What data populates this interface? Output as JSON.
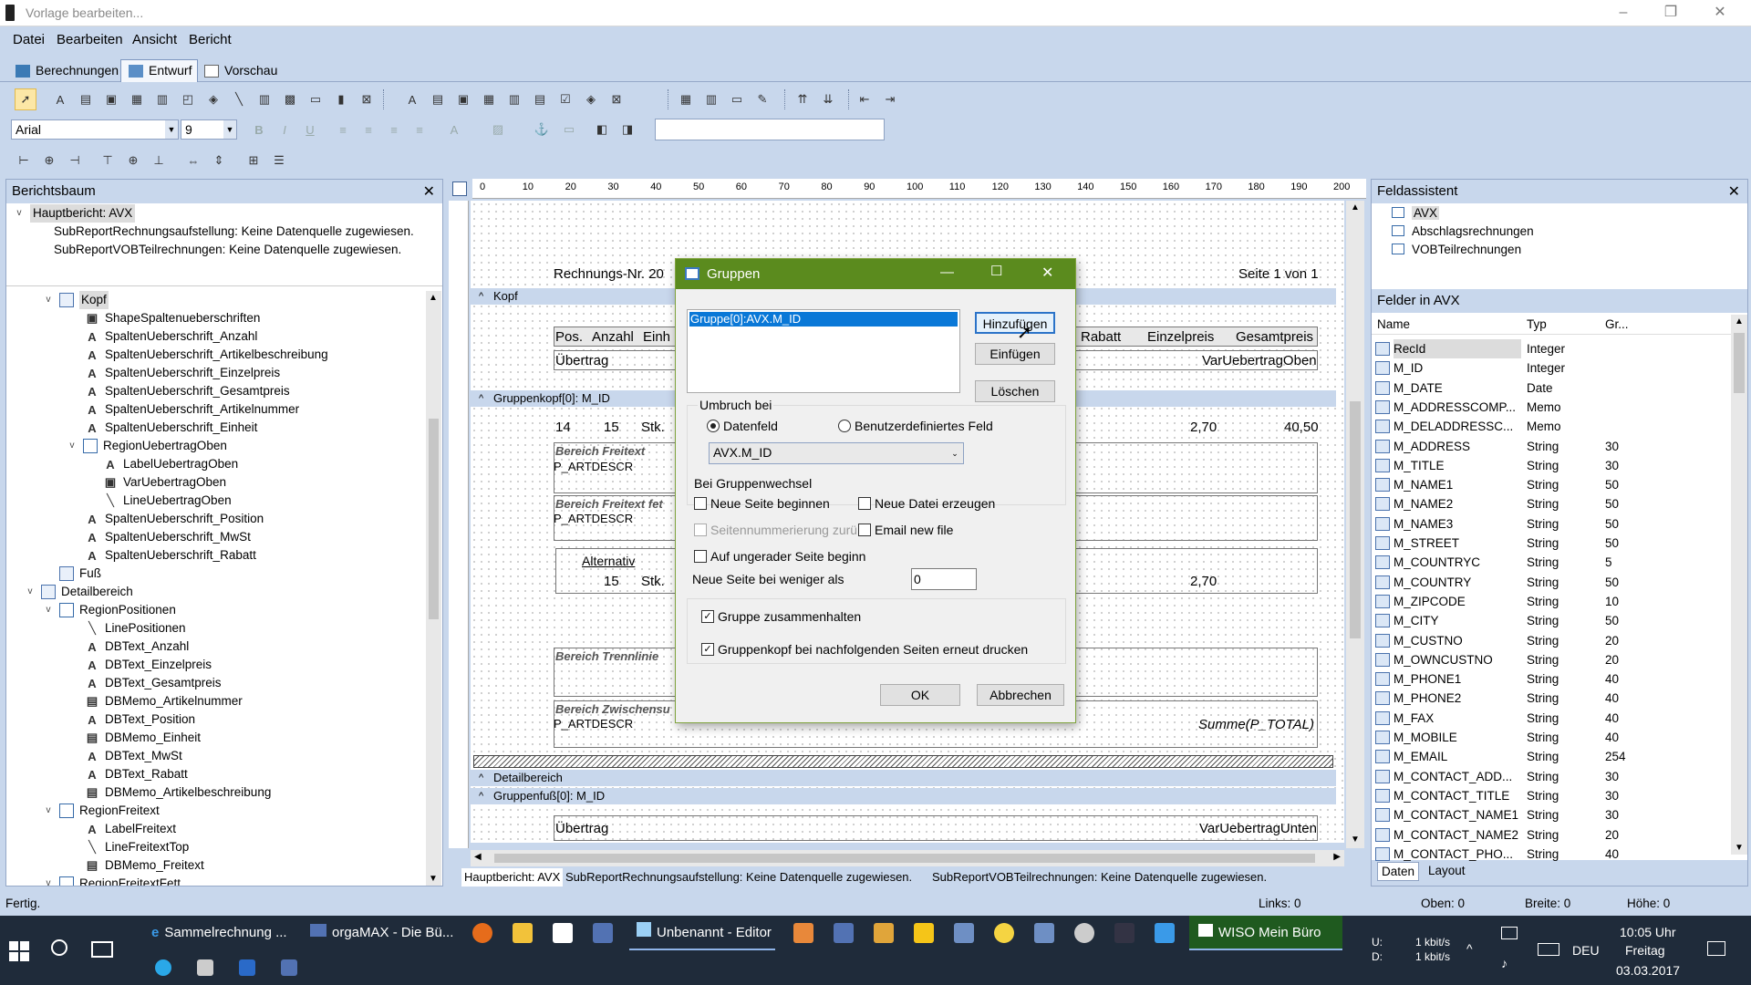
{
  "window": {
    "title": "Vorlage bearbeiten...",
    "minimize": "–",
    "maximize": "❐",
    "close": "✕"
  },
  "menu": [
    "Datei",
    "Bearbeiten",
    "Ansicht",
    "Bericht"
  ],
  "tabs": [
    "Berechnungen",
    "Entwurf",
    "Vorschau"
  ],
  "toolbar": {
    "font": "Arial",
    "size": "9"
  },
  "report_tree": {
    "title": "Berichtsbaum",
    "top": [
      "Hauptbericht: AVX",
      "SubReportRechnungsaufstellung: Keine Datenquelle zugewiesen.",
      "SubReportVOBTeilrechnungen: Keine Datenquelle zugewiesen."
    ],
    "items": [
      "Kopf",
      "ShapeSpaltenueberschriften",
      "SpaltenUeberschrift_Anzahl",
      "SpaltenUeberschrift_Artikelbeschreibung",
      "SpaltenUeberschrift_Einzelpreis",
      "SpaltenUeberschrift_Gesamtpreis",
      "SpaltenUeberschrift_Artikelnummer",
      "SpaltenUeberschrift_Einheit",
      "RegionUebertragOben",
      "LabelUebertragOben",
      "VarUebertragOben",
      "LineUebertragOben",
      "SpaltenUeberschrift_Position",
      "SpaltenUeberschrift_MwSt",
      "SpaltenUeberschrift_Rabatt",
      "Fuß",
      "Detailbereich",
      "RegionPositionen",
      "LinePositionen",
      "DBText_Anzahl",
      "DBText_Einzelpreis",
      "DBText_Gesamtpreis",
      "DBMemo_Artikelnummer",
      "DBText_Position",
      "DBMemo_Einheit",
      "DBText_MwSt",
      "DBText_Rabatt",
      "DBMemo_Artikelbeschreibung",
      "RegionFreitext",
      "LabelFreitext",
      "LineFreitextTop",
      "DBMemo_Freitext",
      "RegionFreitextFett"
    ]
  },
  "ruler": [
    "0",
    "10",
    "20",
    "30",
    "40",
    "50",
    "60",
    "70",
    "80",
    "90",
    "100",
    "110",
    "120",
    "130",
    "140",
    "150",
    "160",
    "170",
    "180",
    "190",
    "200"
  ],
  "design": {
    "rechnungs_nr": "Rechnungs-Nr. 20",
    "seite": "Seite 1 von 1",
    "band_kopf": "Kopf",
    "headers": [
      "Pos.",
      "Anzahl",
      "Einh",
      "Rabatt",
      "Einzelpreis",
      "Gesamtpreis"
    ],
    "uebertrag": "Übertrag",
    "var_uebertrag_oben": "VarUebertragOben",
    "band_gruppenkopf": "Gruppenkopf[0]: M_ID",
    "row_pos": "14",
    "row_anz": "15",
    "row_einh": "Stk.",
    "row_p1": "2,70",
    "row_p2": "40,50",
    "freitext": "Bereich Freitext",
    "artdescr": "P_ARTDESCR",
    "freitext_fett": "Bereich Freitext fet",
    "alternativ": "Alternativ",
    "alt_anz": "15",
    "alt_einh": "Stk.",
    "alt_preis": "2,70",
    "trennlinie": "Bereich Trennlinie",
    "zwischensu": "Bereich Zwischensu",
    "summe": "Summe(P_TOTAL)",
    "band_detail": "Detailbereich",
    "band_gruppenfuss": "Gruppenfuß[0]: M_ID",
    "uebertrag2": "Übertrag",
    "var_uebertrag_unten": "VarUebertragUnten"
  },
  "bottom_tabs": [
    "Hauptbericht: AVX",
    "SubReportRechnungsaufstellung: Keine Datenquelle zugewiesen.",
    "SubReportVOBTeilrechnungen: Keine Datenquelle zugewiesen."
  ],
  "field_wizard": {
    "title": "Feldassistent",
    "sources": [
      "AVX",
      "Abschlagsrechnungen",
      "VOBTeilrechnungen"
    ],
    "fields_title": "Felder in AVX",
    "columns": [
      "Name",
      "Typ",
      "Gr..."
    ],
    "fields": [
      [
        "RecId",
        "Integer",
        ""
      ],
      [
        "M_ID",
        "Integer",
        ""
      ],
      [
        "M_DATE",
        "Date",
        ""
      ],
      [
        "M_ADDRESSCOMP...",
        "Memo",
        ""
      ],
      [
        "M_DELADDRESSC...",
        "Memo",
        ""
      ],
      [
        "M_ADDRESS",
        "String",
        "30"
      ],
      [
        "M_TITLE",
        "String",
        "30"
      ],
      [
        "M_NAME1",
        "String",
        "50"
      ],
      [
        "M_NAME2",
        "String",
        "50"
      ],
      [
        "M_NAME3",
        "String",
        "50"
      ],
      [
        "M_STREET",
        "String",
        "50"
      ],
      [
        "M_COUNTRYC",
        "String",
        "5"
      ],
      [
        "M_COUNTRY",
        "String",
        "50"
      ],
      [
        "M_ZIPCODE",
        "String",
        "10"
      ],
      [
        "M_CITY",
        "String",
        "50"
      ],
      [
        "M_CUSTNO",
        "String",
        "20"
      ],
      [
        "M_OWNCUSTNO",
        "String",
        "20"
      ],
      [
        "M_PHONE1",
        "String",
        "40"
      ],
      [
        "M_PHONE2",
        "String",
        "40"
      ],
      [
        "M_FAX",
        "String",
        "40"
      ],
      [
        "M_MOBILE",
        "String",
        "40"
      ],
      [
        "M_EMAIL",
        "String",
        "254"
      ],
      [
        "M_CONTACT_ADD...",
        "String",
        "30"
      ],
      [
        "M_CONTACT_TITLE",
        "String",
        "30"
      ],
      [
        "M_CONTACT_NAME1",
        "String",
        "30"
      ],
      [
        "M_CONTACT_NAME2",
        "String",
        "20"
      ],
      [
        "M_CONTACT_PHO...",
        "String",
        "40"
      ]
    ],
    "tabs": [
      "Daten",
      "Layout"
    ]
  },
  "dialog": {
    "title": "Gruppen",
    "list_item": "Gruppe[0]:AVX.M_ID",
    "btn_add": "Hinzufügen",
    "btn_insert": "Einfügen",
    "btn_delete": "Löschen",
    "umbruch_label": "Umbruch bei",
    "radio_datenfeld": "Datenfeld",
    "radio_custom": "Benutzerdefiniertes Feld",
    "field_value": "AVX.M_ID",
    "wechsel_label": "Bei Gruppenwechsel",
    "cb_new_page": "Neue Seite beginnen",
    "cb_new_file": "Neue Datei erzeugen",
    "cb_page_reset": "Seitennummerierung zurück",
    "cb_email": "Email new file",
    "cb_odd_page": "Auf ungerader Seite beginn",
    "less_than_label": "Neue Seite bei weniger als",
    "less_than_value": "0",
    "cb_keep_together": "Gruppe zusammenhalten",
    "cb_reprint_header": "Gruppenkopf bei nachfolgenden Seiten erneut drucken",
    "btn_ok": "OK",
    "btn_cancel": "Abbrechen"
  },
  "status": {
    "left": "Fertig.",
    "links": "Links: 0",
    "oben": "Oben: 0",
    "breite": "Breite: 0",
    "hoehe": "Höhe: 0"
  },
  "taskbar": {
    "items": [
      "Sammelrechnung ...",
      "orgaMAX - Die Bü...",
      "Unbenannt - Editor",
      "WISO Mein Büro"
    ],
    "net_u_label": "U:",
    "net_d_label": "D:",
    "net_u": "1 kbit/s",
    "net_d": "1 kbit/s",
    "lang": "DEU",
    "time": "10:05 Uhr",
    "day": "Freitag",
    "date": "03.03.2017"
  },
  "colors": {
    "accent": "#c8d7ec",
    "dialog_title": "#5b8b1e",
    "taskbar": "#1f2b3a"
  }
}
